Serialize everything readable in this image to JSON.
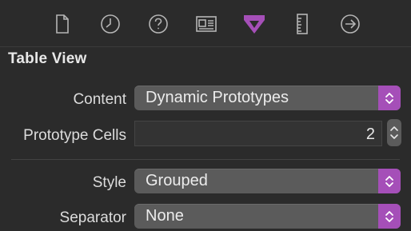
{
  "toolbar": {
    "icons": [
      {
        "name": "file-inspector-icon"
      },
      {
        "name": "history-inspector-icon"
      },
      {
        "name": "quick-help-icon"
      },
      {
        "name": "identity-inspector-icon"
      },
      {
        "name": "attributes-inspector-icon",
        "active": true
      },
      {
        "name": "size-inspector-icon"
      },
      {
        "name": "connections-inspector-icon"
      }
    ],
    "icon_color": "#b5b5b5",
    "active_color": "#a54fb8"
  },
  "section": {
    "title": "Table View"
  },
  "fields": {
    "content": {
      "label": "Content",
      "value": "Dynamic Prototypes"
    },
    "prototype_cells": {
      "label": "Prototype Cells",
      "value": "2"
    },
    "style": {
      "label": "Style",
      "value": "Grouped"
    },
    "separator": {
      "label": "Separator",
      "value": "None"
    }
  },
  "colors": {
    "background": "#2b2b2b",
    "popup_bg": "#5b5b5b",
    "accent": "#a54fb8",
    "text": "#e2e2e2"
  }
}
